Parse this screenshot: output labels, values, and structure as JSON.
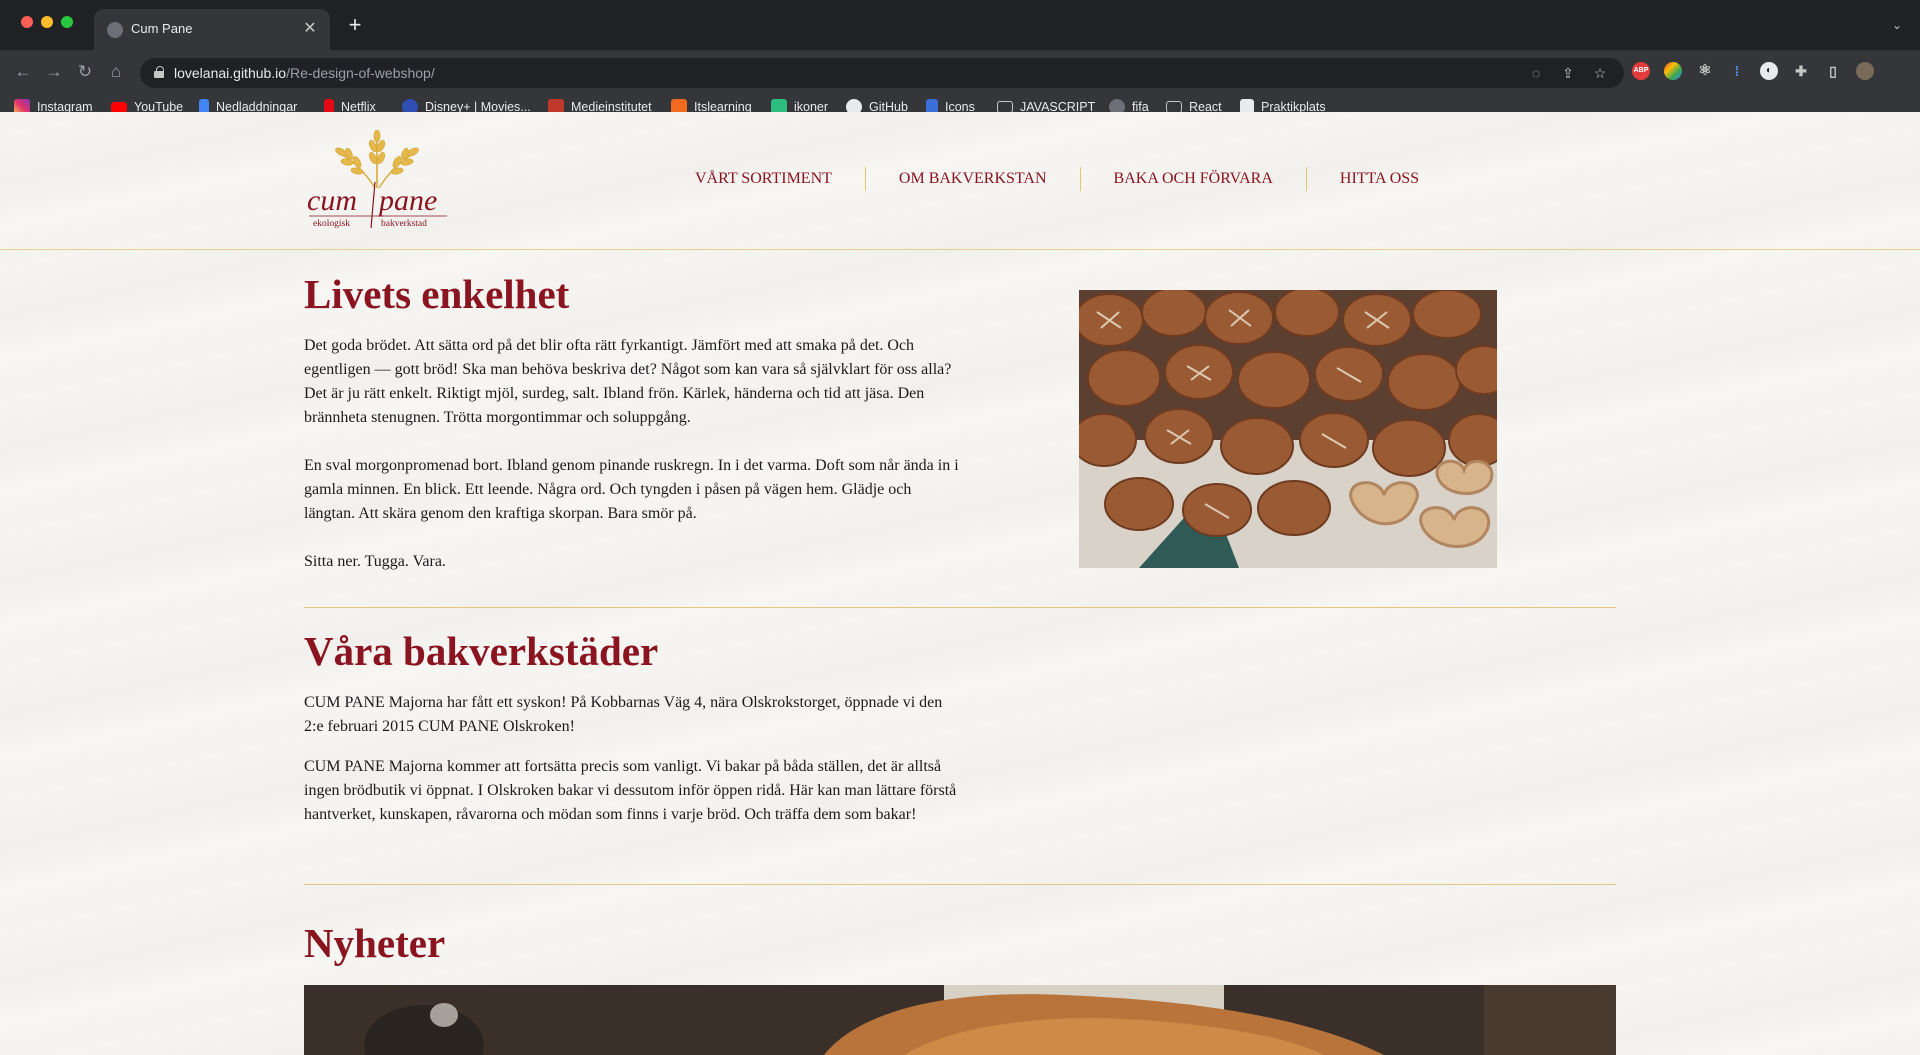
{
  "browser": {
    "tab_title": "Cum Pane",
    "url_host": "lovelanai.github.io",
    "url_path": "/Re-design-of-webshop/",
    "bookmarks": [
      "Instagram",
      "YouTube",
      "Nedladdningar",
      "Netflix",
      "Disney+ | Movies...",
      "Medieinstitutet",
      "Itslearning",
      "ikoner",
      "GitHub",
      "Icons",
      "JAVASCRIPT",
      "fifa",
      "React",
      "Praktikplats"
    ],
    "extension_abp": "ABP"
  },
  "site": {
    "logo": {
      "word1": "cum",
      "word2": "pane",
      "sub1": "ekologisk",
      "sub2": "bakverkstad"
    },
    "nav": [
      "VÅRT SORTIMENT",
      "OM BAKVERKSTAN",
      "BAKA OCH FÖRVARA",
      "HITTA OSS"
    ]
  },
  "intro": {
    "heading": "Livets enkelhet",
    "paragraphs": [
      "Det goda brödet. Att sätta ord på det blir ofta rätt fyrkantigt. Jämfört med att smaka på det. Och egentligen — gott bröd! Ska man behöva beskriva det? Något som kan vara så självklart för oss alla? Det är ju rätt enkelt. Riktigt mjöl, surdeg, salt. Ibland frön. Kärlek, händerna och tid att jäsa. Den brännheta stenugnen. Trötta morgontimmar och soluppgång.",
      "En sval morgonpromenad bort. Ibland genom pinande ruskregn. In i det varma. Doft som når ända in i gamla minnen. En blick. Ett leende. Några ord. Och tyngden i påsen på vägen hem. Glädje och längtan. Att skära genom den kraftiga skorpan. Bara smör på.",
      "Sitta ner. Tugga. Vara."
    ]
  },
  "bakeries": {
    "heading": "Våra bakverkstäder",
    "paragraphs": [
      "CUM PANE Majorna har fått ett syskon! På Kobbarnas Väg 4, nära Olskrokstorget, öppnade vi den 2:e februari 2015 CUM PANE Olskroken!",
      "CUM PANE Majorna kommer att fortsätta precis som vanligt. Vi bakar på båda ställen, det är alltså ingen brödbutik vi öppnat. I Olskroken bakar vi dessutom inför öppen ridå. Här kan man lättare förstå hantverket, kunskapen, råvarorna och mödan som finns i varje bröd. Och träffa dem som bakar!"
    ]
  },
  "news": {
    "heading": "Nyheter"
  },
  "colors": {
    "brand_red": "#8a1420",
    "accent_gold": "#e2c57e",
    "chrome_dark": "#202124"
  }
}
